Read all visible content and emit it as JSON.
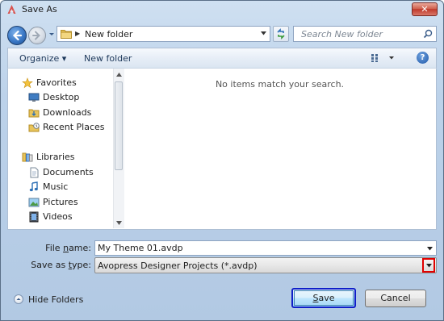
{
  "window": {
    "title": "Save As",
    "close_label": "✕"
  },
  "address": {
    "crumb": "New folder",
    "search_placeholder": "Search New folder"
  },
  "toolbar": {
    "organize_label": "Organize ▾",
    "new_folder_label": "New folder",
    "help_label": "?"
  },
  "nav": {
    "items": [
      {
        "label": "Favorites",
        "icon": "star-icon"
      },
      {
        "label": "Desktop",
        "icon": "desktop-icon"
      },
      {
        "label": "Downloads",
        "icon": "downloads-folder-icon"
      },
      {
        "label": "Recent Places",
        "icon": "recent-places-icon"
      },
      {
        "label": "Libraries",
        "icon": "libraries-icon"
      },
      {
        "label": "Documents",
        "icon": "documents-icon"
      },
      {
        "label": "Music",
        "icon": "music-icon"
      },
      {
        "label": "Pictures",
        "icon": "pictures-icon"
      },
      {
        "label": "Videos",
        "icon": "videos-icon"
      }
    ]
  },
  "main": {
    "empty_message": "No items match your search."
  },
  "fields": {
    "file_name_label_pre": "File ",
    "file_name_label_key": "n",
    "file_name_label_post": "ame:",
    "file_name_value": "My Theme 01.avdp",
    "save_type_label_pre": "Save as ",
    "save_type_label_key": "t",
    "save_type_label_post": "ype:",
    "save_type_value": "Avopress Designer Projects (*.avdp)"
  },
  "footer": {
    "hide_folders_label": "Hide Folders",
    "save_key": "S",
    "save_rest": "ave",
    "cancel_label": "Cancel"
  },
  "colors": {
    "highlight_outline": "#e00000",
    "focus_outline": "#1020c8",
    "window_frame": "#bcd2ea"
  }
}
